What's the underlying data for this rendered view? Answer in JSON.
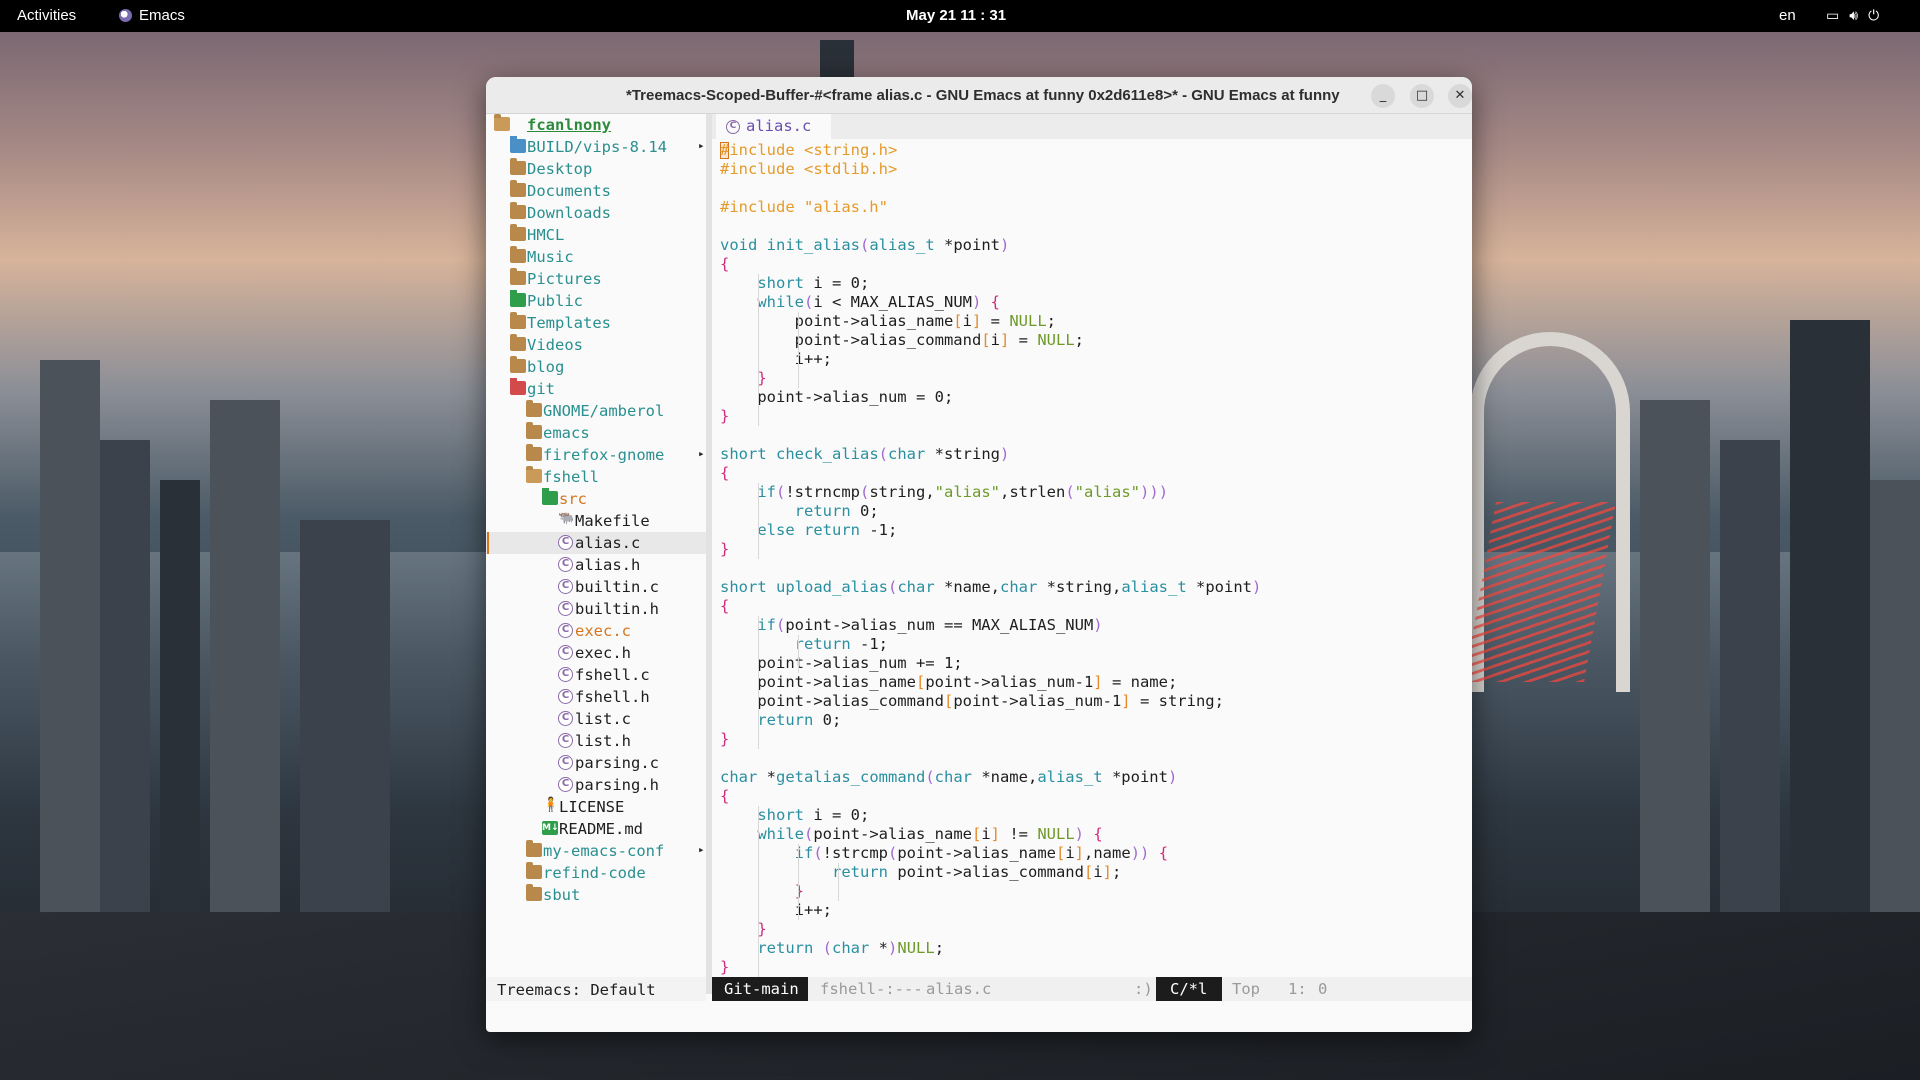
{
  "topbar": {
    "activities": "Activities",
    "app_name": "Emacs",
    "clock": "May 21  11 : 31",
    "lang": "en"
  },
  "window": {
    "title": "*Treemacs-Scoped-Buffer-#<frame alias.c - GNU Emacs at funny 0x2d611e8>* - GNU Emacs at funny",
    "buttons": {
      "minimize": "_",
      "maximize": "□",
      "close": "✕"
    }
  },
  "treemacs": {
    "root": "fcanlnony",
    "modeline": "Treemacs: Default",
    "items": [
      {
        "label": "BUILD/vips-8.14",
        "icon": "folder-blue-icon",
        "level": 1,
        "style": "dir",
        "collapsed_more": true
      },
      {
        "label": "Desktop",
        "icon": "folder-icon",
        "level": 1,
        "style": "dir"
      },
      {
        "label": "Documents",
        "icon": "folder-icon",
        "level": 1,
        "style": "dir"
      },
      {
        "label": "Downloads",
        "icon": "folder-icon",
        "level": 1,
        "style": "dir"
      },
      {
        "label": "HMCL",
        "icon": "folder-icon",
        "level": 1,
        "style": "dir"
      },
      {
        "label": "Music",
        "icon": "folder-icon",
        "level": 1,
        "style": "dir"
      },
      {
        "label": "Pictures",
        "icon": "folder-icon",
        "level": 1,
        "style": "dir"
      },
      {
        "label": "Public",
        "icon": "folder-green-icon",
        "level": 1,
        "style": "dir"
      },
      {
        "label": "Templates",
        "icon": "folder-icon",
        "level": 1,
        "style": "dir"
      },
      {
        "label": "Videos",
        "icon": "folder-icon",
        "level": 1,
        "style": "dir"
      },
      {
        "label": "blog",
        "icon": "folder-icon",
        "level": 1,
        "style": "dir"
      },
      {
        "label": "git",
        "icon": "folder-red-icon",
        "level": 1,
        "style": "dir"
      },
      {
        "label": "GNOME/amberol",
        "icon": "folder-icon",
        "level": 2,
        "style": "dir"
      },
      {
        "label": "emacs",
        "icon": "folder-icon",
        "level": 2,
        "style": "dir"
      },
      {
        "label": "firefox-gnome",
        "icon": "folder-icon",
        "level": 2,
        "style": "dir",
        "collapsed_more": true
      },
      {
        "label": "fshell",
        "icon": "folder-open-icon",
        "level": 2,
        "style": "dir"
      },
      {
        "label": "src",
        "icon": "folder-green-icon",
        "level": 3,
        "style": "srcd"
      },
      {
        "label": "Makefile",
        "icon": "makefile-icon",
        "level": 4,
        "style": "file"
      },
      {
        "label": "alias.c",
        "icon": "c-file-icon",
        "level": 4,
        "style": "file",
        "selected": true
      },
      {
        "label": "alias.h",
        "icon": "c-file-icon",
        "level": 4,
        "style": "file"
      },
      {
        "label": "builtin.c",
        "icon": "c-file-icon",
        "level": 4,
        "style": "file"
      },
      {
        "label": "builtin.h",
        "icon": "c-file-icon",
        "level": 4,
        "style": "file"
      },
      {
        "label": "exec.c",
        "icon": "c-file-icon",
        "level": 4,
        "style": "mod"
      },
      {
        "label": "exec.h",
        "icon": "c-file-icon",
        "level": 4,
        "style": "file"
      },
      {
        "label": "fshell.c",
        "icon": "c-file-icon",
        "level": 4,
        "style": "file"
      },
      {
        "label": "fshell.h",
        "icon": "c-file-icon",
        "level": 4,
        "style": "file"
      },
      {
        "label": "list.c",
        "icon": "c-file-icon",
        "level": 4,
        "style": "file"
      },
      {
        "label": "list.h",
        "icon": "c-file-icon",
        "level": 4,
        "style": "file"
      },
      {
        "label": "parsing.c",
        "icon": "c-file-icon",
        "level": 4,
        "style": "file"
      },
      {
        "label": "parsing.h",
        "icon": "c-file-icon",
        "level": 4,
        "style": "file"
      },
      {
        "label": "LICENSE",
        "icon": "license-icon",
        "level": 3,
        "style": "file"
      },
      {
        "label": "README.md",
        "icon": "markdown-icon",
        "level": 3,
        "style": "file"
      },
      {
        "label": "my-emacs-conf",
        "icon": "folder-icon",
        "level": 2,
        "style": "dir",
        "collapsed_more": true
      },
      {
        "label": "refind-code",
        "icon": "folder-icon",
        "level": 2,
        "style": "dir"
      },
      {
        "label": "sbut",
        "icon": "folder-icon",
        "level": 2,
        "style": "dir"
      }
    ]
  },
  "editor": {
    "tab_label": "alias.c",
    "lines": [
      "#include <string.h>",
      "#include <stdlib.h>",
      "",
      "#include \"alias.h\"",
      "",
      "void init_alias(alias_t *point)",
      "{",
      "    short i = 0;",
      "    while(i < MAX_ALIAS_NUM) {",
      "        point->alias_name[i] = NULL;",
      "        point->alias_command[i] = NULL;",
      "        i++;",
      "    }",
      "    point->alias_num = 0;",
      "}",
      "",
      "short check_alias(char *string)",
      "{",
      "    if(!strncmp(string,\"alias\",strlen(\"alias\")))",
      "        return 0;",
      "    else return -1;",
      "}",
      "",
      "short upload_alias(char *name,char *string,alias_t *point)",
      "{",
      "    if(point->alias_num == MAX_ALIAS_NUM)",
      "        return -1;",
      "    point->alias_num += 1;",
      "    point->alias_name[point->alias_num-1] = name;",
      "    point->alias_command[point->alias_num-1] = string;",
      "    return 0;",
      "}",
      "",
      "char *getalias_command(char *name,alias_t *point)",
      "{",
      "    short i = 0;",
      "    while(point->alias_name[i] != NULL) {",
      "        if(!strcmp(point->alias_name[i],name)) {",
      "            return point->alias_command[i];",
      "        }",
      "        i++;",
      "    }",
      "    return (char *)NULL;",
      "}"
    ]
  },
  "modeline": {
    "git": "Git-main",
    "buffer_state": "fshell-:---",
    "buffer_name": "alias.c",
    "face": ":)",
    "mode": "C/*l",
    "position": "Top",
    "line": "1:",
    "column": "0"
  },
  "colors": {
    "keyword": "#2a8fa0",
    "preprocessor": "#e59a2a",
    "string": "#6f9a2a",
    "param": "#d4761b",
    "brace": "#d02a7a",
    "treemacs_dir": "#2a8f8f",
    "treemacs_root": "#2e8b3e"
  }
}
